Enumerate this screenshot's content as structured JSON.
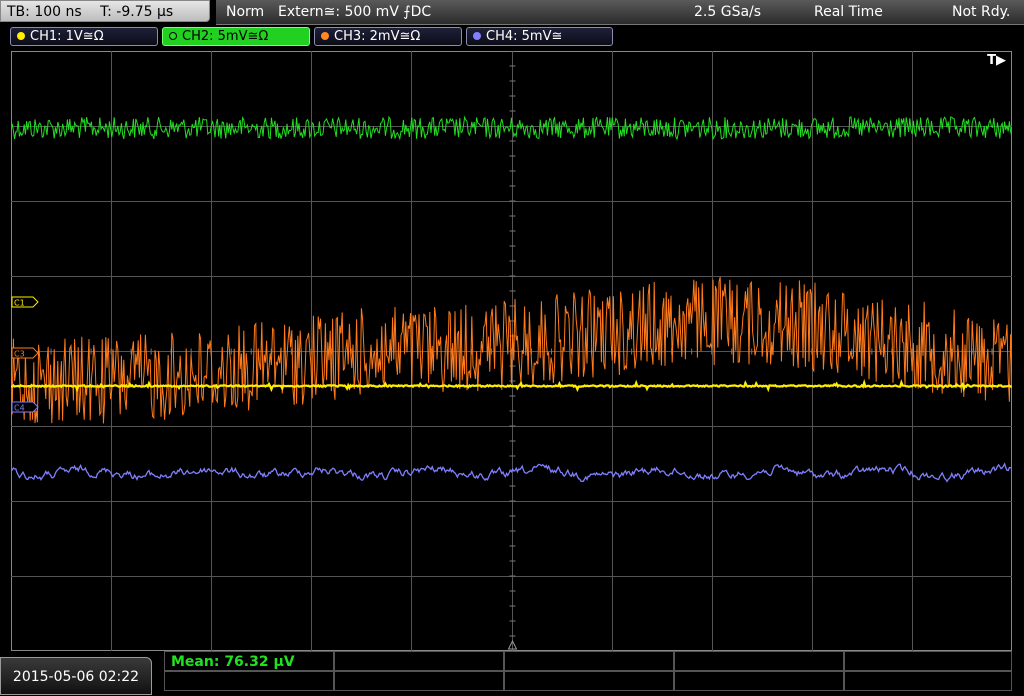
{
  "topbar": {
    "timebase": "TB: 100 ns",
    "trigger_time": "T: -9.75 µs",
    "trigger_mode": "Norm",
    "trigger_source": "Extern≅: 500 mV ⨍DC",
    "sample_rate": "2.5 GSa/s",
    "acq_mode": "Real Time",
    "status": "Not Rdy."
  },
  "channels": [
    {
      "label": "CH1: 1V≅Ω",
      "color": "#ffee00",
      "active": false
    },
    {
      "label": "CH2: 5mV≅Ω",
      "color": "#22dd22",
      "active": true
    },
    {
      "label": "CH3: 2mV≅Ω",
      "color": "#ff8822",
      "active": false
    },
    {
      "label": "CH4: 5mV≅",
      "color": "#8080ff",
      "active": false
    }
  ],
  "markers": {
    "c1": "C1",
    "c3": "C3",
    "c4": "C4",
    "trigger_pos": "T▶"
  },
  "bottom": {
    "datetime": "2015-05-06 02:22",
    "measurement": "Mean: 76.32 µV"
  },
  "colors": {
    "grid": "#555555",
    "ch1": "#ffee00",
    "ch2": "#22dd22",
    "ch3": "#ff7a1a",
    "ch4": "#7f7fff",
    "measure_text": "#22e022"
  }
}
